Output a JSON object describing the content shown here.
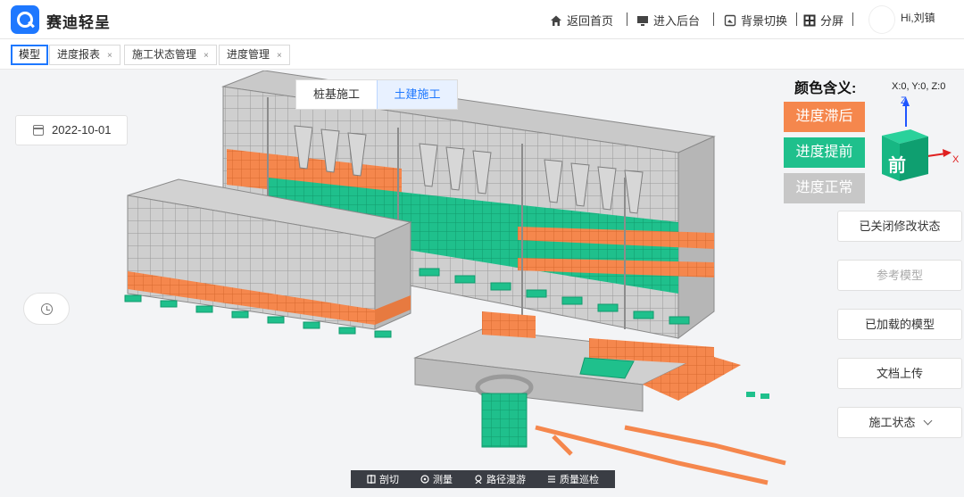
{
  "app": {
    "title": "赛迪轻呈"
  },
  "header": {
    "nav": [
      {
        "id": "home",
        "label": "返回首页"
      },
      {
        "id": "backend",
        "label": "进入后台"
      },
      {
        "id": "background",
        "label": "背景切换"
      },
      {
        "id": "split",
        "label": "分屏"
      }
    ],
    "greeting": "Hi,刘镇"
  },
  "tabs": [
    {
      "label": "模型",
      "active": true,
      "closable": false
    },
    {
      "label": "进度报表",
      "active": false,
      "closable": true
    },
    {
      "label": "施工状态管理",
      "active": false,
      "closable": true
    },
    {
      "label": "进度管理",
      "active": false,
      "closable": true
    }
  ],
  "tab_close_glyph": "×",
  "viewport": {
    "mode_toggle": [
      "桩基施工",
      "土建施工"
    ],
    "active_mode": "土建施工",
    "date": "2022-10-01"
  },
  "legend": {
    "title": "颜色含义:",
    "items": [
      {
        "label": "进度滞后",
        "color": "#f5874d"
      },
      {
        "label": "进度提前",
        "color": "#1fc08c"
      },
      {
        "label": "进度正常",
        "color": "#c7c7c7"
      }
    ]
  },
  "view_cube": {
    "coordinates": "X:0, Y:0, Z:0",
    "face_label": "前",
    "axis_x": "X",
    "axis_z": "Z",
    "colors": {
      "x": "#e02020",
      "z": "#1e55ff",
      "cube": "#17b783"
    }
  },
  "side_buttons": [
    {
      "label": "已关闭修改状态",
      "disabled": false
    },
    {
      "label": "参考模型",
      "disabled": true
    },
    {
      "label": "已加载的模型",
      "disabled": false
    },
    {
      "label": "文档上传",
      "disabled": false
    },
    {
      "label": "施工状态",
      "disabled": false,
      "dropdown": true
    }
  ],
  "toolbar": [
    {
      "label": "剖切",
      "icon": "section-icon"
    },
    {
      "label": "测量",
      "icon": "measure-icon"
    },
    {
      "label": "路径漫游",
      "icon": "walk-icon"
    },
    {
      "label": "质量巡检",
      "icon": "inspect-icon"
    }
  ],
  "model_colors": {
    "late": "#f5874d",
    "early": "#1fc08c",
    "normal": "#c8c8c8",
    "edge": "#8a8a8a"
  }
}
